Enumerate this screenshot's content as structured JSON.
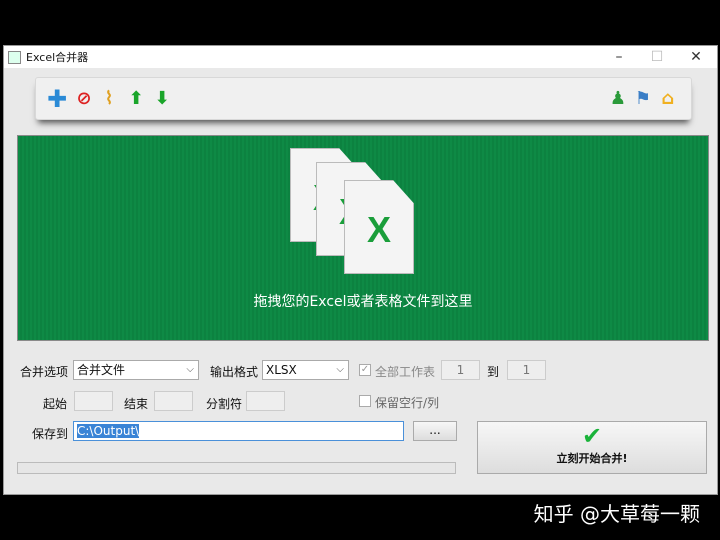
{
  "window": {
    "title": "Excel合并器",
    "minimize": "–",
    "maximize": "☐",
    "close": "✕"
  },
  "toolbar": {
    "left_icons": [
      "add-icon",
      "remove-icon",
      "clear-broom-icon",
      "move-up-icon",
      "move-down-icon"
    ],
    "right_icons": [
      "user-icon",
      "flag-icon",
      "home-icon"
    ]
  },
  "dropzone": {
    "text": "拖拽您的Excel或者表格文件到这里",
    "file_glyph": "X"
  },
  "options": {
    "merge_label": "合并选项",
    "merge_value": "合并文件",
    "format_label": "输出格式",
    "format_value": "XLSX",
    "all_sheets_label": "全部工作表",
    "all_sheets_checked": true,
    "sheet_from": "1",
    "to_label": "到",
    "sheet_to": "1",
    "start_label": "起始",
    "end_label": "结束",
    "separator_label": "分割符",
    "keep_empty_label": "保留空行/列",
    "keep_empty_checked": false,
    "save_label": "保存到",
    "save_value": "C:\\Output\\",
    "browse_label": "...",
    "start_button": "立刻开始合并!"
  },
  "progress": 0,
  "watermark": "知乎 @大草莓一颗"
}
